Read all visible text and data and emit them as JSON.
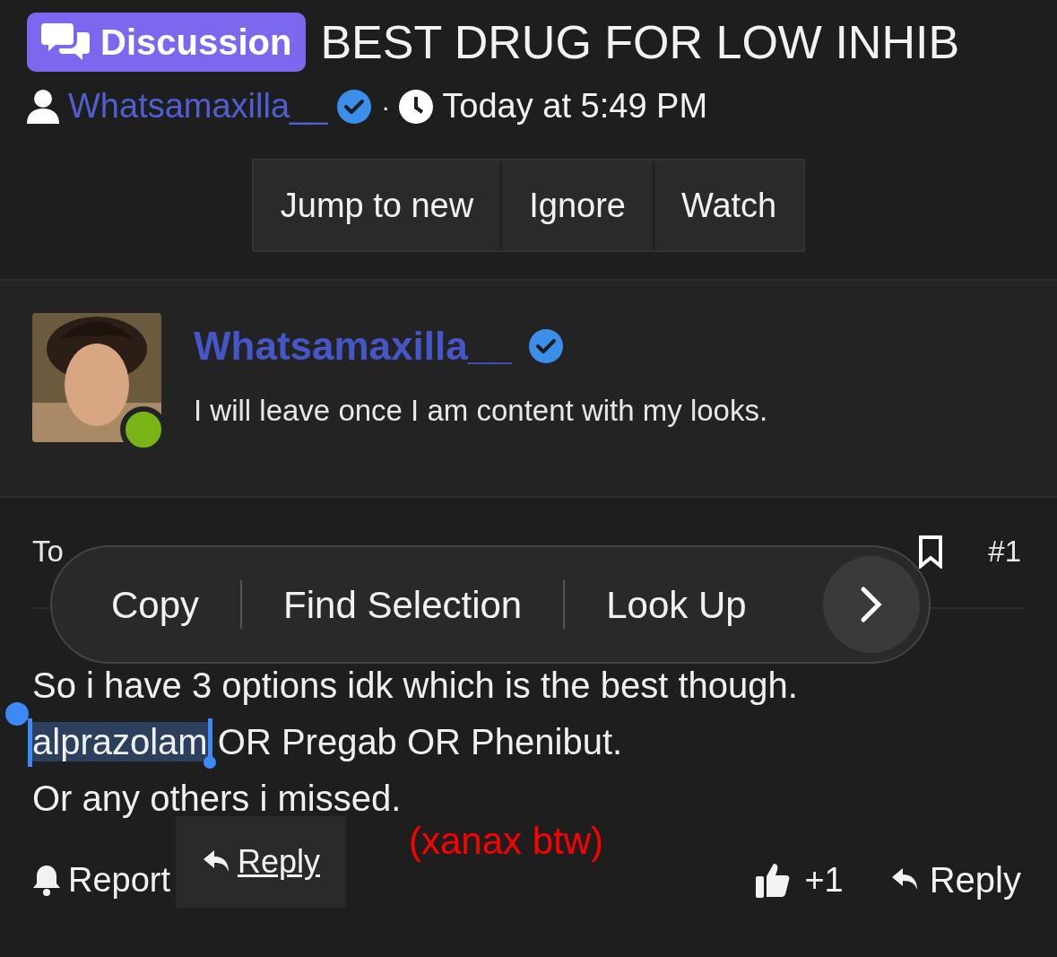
{
  "thread": {
    "badge": "Discussion",
    "title": "BEST DRUG FOR LOW INHIB",
    "author": "Whatsamaxilla__",
    "author_verified": true,
    "separator": "·",
    "time": "Today at 5:49 PM"
  },
  "thread_actions": [
    "Jump to new",
    "Ignore",
    "Watch"
  ],
  "post": {
    "author": "Whatsamaxilla__",
    "verified": true,
    "online": true,
    "signature": "I will leave once I am content with my looks.",
    "date": "To",
    "number": "#1",
    "lines": [
      [
        {
          "text": "So i have 3 options idk which is the best though.",
          "selected": false
        }
      ],
      [
        {
          "text": "alprazolam",
          "selected": true
        },
        {
          "text": " OR Pregab OR Phenibut.",
          "selected": false
        }
      ],
      [
        {
          "text": "Or any others i missed.",
          "selected": false
        }
      ]
    ],
    "annotation": "(xanax btw)",
    "report": "Report",
    "likes": "+1",
    "reply": "Reply"
  },
  "context_menu": {
    "items": [
      "Copy",
      "Find Selection",
      "Look Up"
    ]
  },
  "tooltip": {
    "link": "Reply"
  }
}
